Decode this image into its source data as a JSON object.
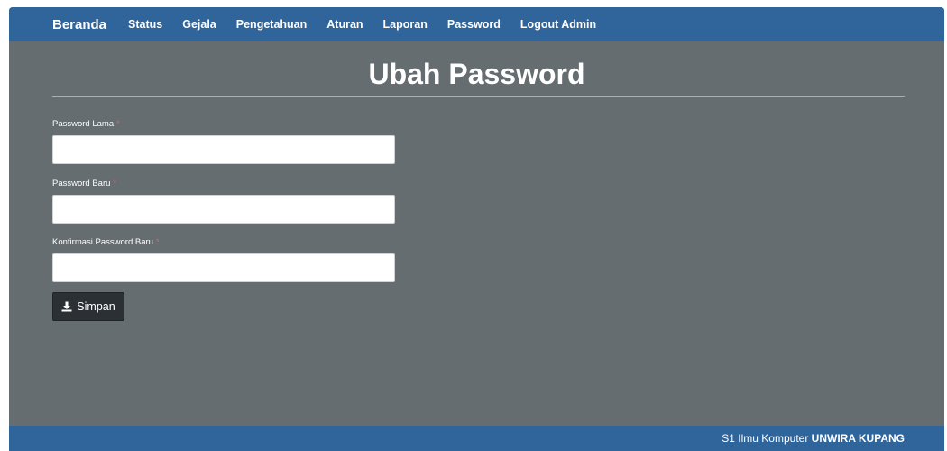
{
  "navbar": {
    "brand": "Beranda",
    "links": [
      "Status",
      "Gejala",
      "Pengetahuan",
      "Aturan",
      "Laporan",
      "Password",
      "Logout Admin"
    ]
  },
  "page": {
    "title": "Ubah Password"
  },
  "form": {
    "old_password_label": "Password Lama",
    "new_password_label": "Password Baru",
    "confirm_password_label": "Konfirmasi Password Baru",
    "required_marker": "*",
    "old_password_value": "",
    "new_password_value": "",
    "confirm_password_value": "",
    "save_label": "Simpan",
    "save_icon": "download-icon"
  },
  "footer": {
    "text": "S1 Ilmu Komputer",
    "bold_text": "UNWIRA KUPANG"
  },
  "colors": {
    "navbar": "#2f659b",
    "background": "#656d71",
    "button": "#2b3034",
    "required": "#c0706e"
  }
}
